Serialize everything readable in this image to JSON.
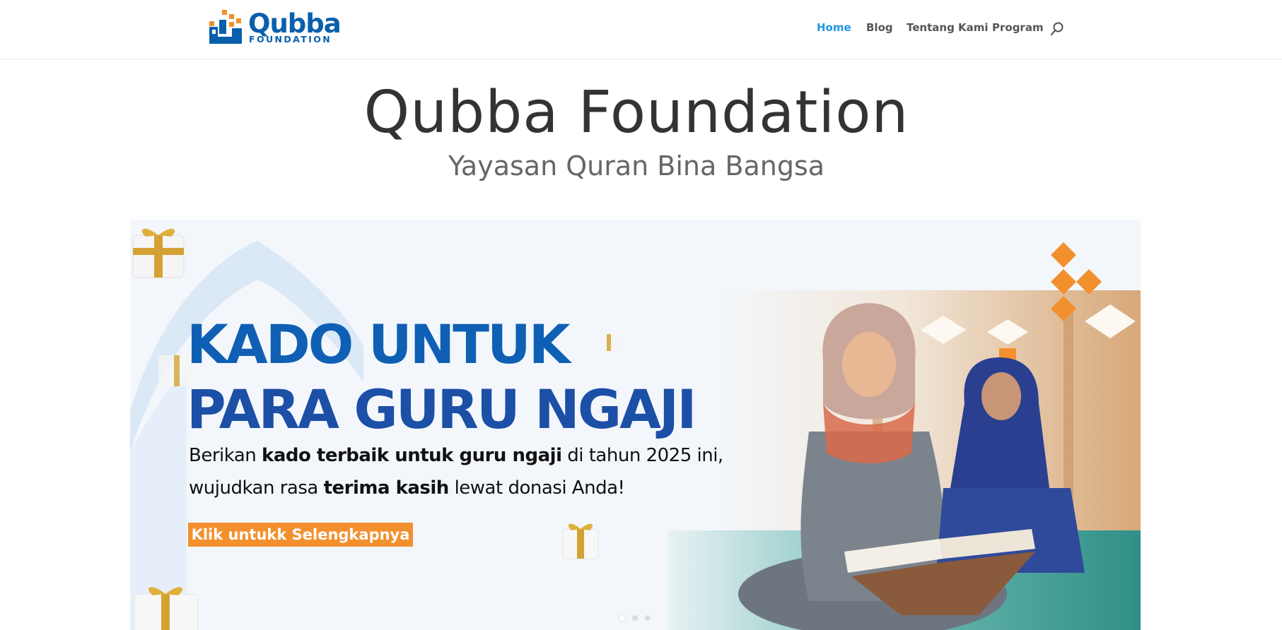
{
  "brand": {
    "name": "Qubba",
    "subname": "FOUNDATION",
    "primary_color": "#0a5fad",
    "accent_color": "#f2902e"
  },
  "nav": {
    "items": [
      {
        "label": "Home",
        "active": true
      },
      {
        "label": "Blog",
        "active": false
      },
      {
        "label": "Tentang Kami",
        "active": false
      },
      {
        "label": "Program",
        "active": false
      }
    ],
    "search_icon": "search-icon"
  },
  "hero": {
    "title": "Qubba Foundation",
    "tagline": "Yayasan Quran Bina Bangsa"
  },
  "banner": {
    "headline_line1": "KADO UNTUK",
    "headline_line2": "PARA GURU NGAJI",
    "body_line1_prefix": "Berikan ",
    "body_line1_bold": "kado terbaik untuk guru ngaji",
    "body_line1_suffix": " di tahun 2025 ini,",
    "body_line2_prefix": "wujudkan rasa ",
    "body_line2_bold": "terima kasih",
    "body_line2_suffix": " lewat donasi Anda!",
    "cta_label": "Klik untukk Selengkapnya",
    "slides_total": 3,
    "slide_active": 1
  }
}
